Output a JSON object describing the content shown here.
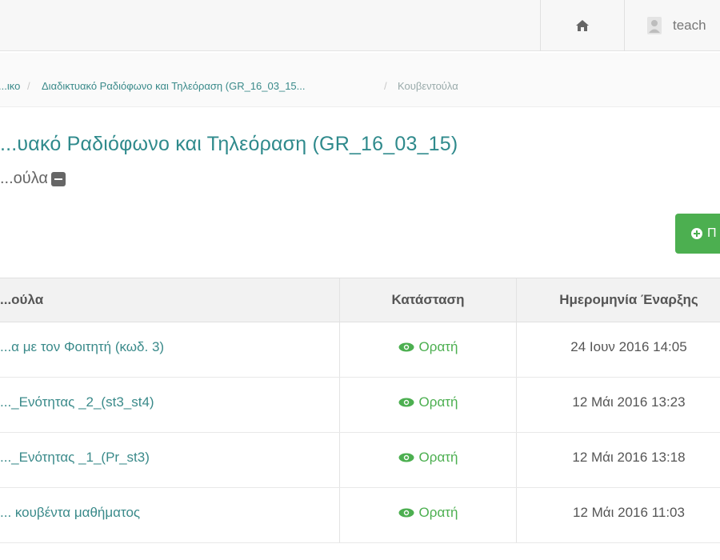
{
  "topbar": {
    "user_name": "teach"
  },
  "breadcrumb": {
    "items": [
      {
        "label": "...ικο",
        "type": "link"
      },
      {
        "label": "Διαδικτυακό Ραδιόφωνο και Τηλεόραση (GR_16_03_15...",
        "type": "link"
      },
      {
        "label": "Κουβεντούλα",
        "type": "active"
      }
    ],
    "separator": "/"
  },
  "page": {
    "title": "...υακό Ραδιόφωνο και Τηλεόραση (GR_16_03_15)",
    "subtitle": "...ούλα"
  },
  "add_button": {
    "label": "Π"
  },
  "table": {
    "headers": [
      "...ούλα",
      "Κατάσταση",
      "Ημερομηνία Έναρξης"
    ],
    "rows": [
      {
        "name": "...α με τον Φοιτητή (κωδ. 3)",
        "status": "Ορατή",
        "date": "24 Ιουν 2016 14:05"
      },
      {
        "name": "..._Ενότητας _2_(st3_st4)",
        "status": "Ορατή",
        "date": "12 Μάι 2016 13:23"
      },
      {
        "name": "..._Ενότητας _1_(Pr_st3)",
        "status": "Ορατή",
        "date": "12 Μάι 2016 13:18"
      },
      {
        "name": "... κουβέντα μαθήματος",
        "status": "Ορατή",
        "date": "12 Μάι 2016 11:03"
      }
    ]
  },
  "colors": {
    "accent": "#2f8a8c",
    "success": "#4caf50",
    "muted": "#777777"
  },
  "icons": {
    "home": "home-icon",
    "user": "user-icon",
    "collapse": "minus-square-icon",
    "add": "plus-circle-icon",
    "visible": "eye-icon"
  }
}
